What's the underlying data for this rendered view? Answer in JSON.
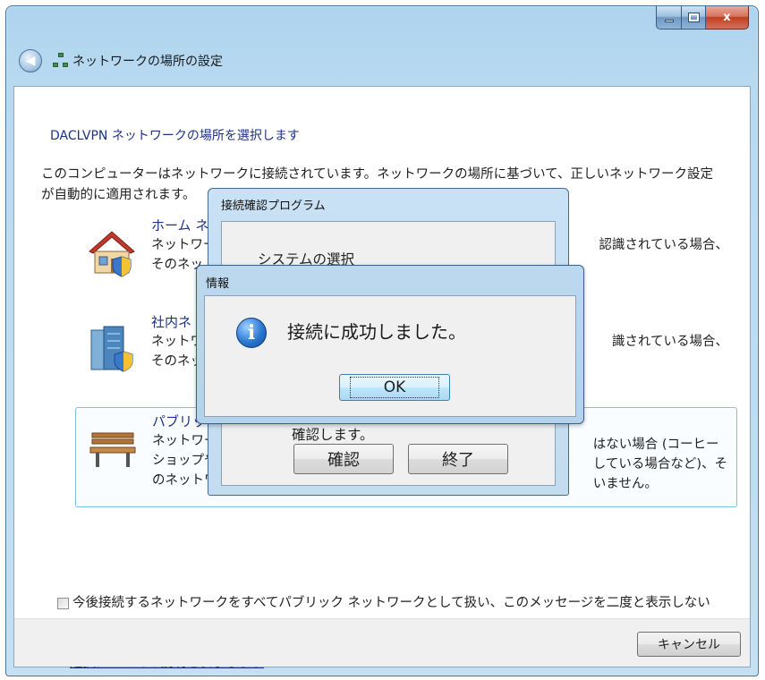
{
  "window": {
    "title": "ネットワークの場所の設定",
    "caption_buttons": {
      "minimize": "",
      "maximize": "",
      "close": "x"
    }
  },
  "content": {
    "heading": "DACLVPN ネットワークの場所を選択します",
    "description": "このコンピューターはネットワークに接続されています。ネットワークの場所に基づいて、正しいネットワーク設定が自動的に適用されます。",
    "options": [
      {
        "id": "home",
        "icon": "home-network-icon",
        "title": "ホーム ネ",
        "line1": "ネットワー",
        "line2": "そのネッ",
        "right1": "認識されている場合、"
      },
      {
        "id": "work",
        "icon": "work-network-icon",
        "title": "社内ネ",
        "line1": "ネットワ",
        "line2": "そのネッ",
        "right1": "識されている場合、"
      },
      {
        "id": "public",
        "icon": "public-network-bench-icon",
        "title": "パブリッ",
        "line1": "ネットワー",
        "line2": "ショップや",
        "line3": "のネットワ",
        "right1": "はない場合 (コーヒー",
        "right2": "している場合など)、そ",
        "right3": "いません。"
      }
    ],
    "checkbox_label": "今後接続するネットワークをすべてパブリック ネットワークとして扱い、このメッセージを二度と表示しない",
    "help_link": "選択についての説明を表示します"
  },
  "footer": {
    "cancel_label": "キャンセル"
  },
  "connection_dialog": {
    "title": "接続確認プログラム",
    "group_label": "システムの選択",
    "confirm_text": "確認します。",
    "confirm_button": "確認",
    "exit_button": "終了"
  },
  "info_dialog": {
    "title": "情報",
    "icon": "info-icon",
    "message": "接続に成功しました。",
    "ok_label": "OK"
  }
}
